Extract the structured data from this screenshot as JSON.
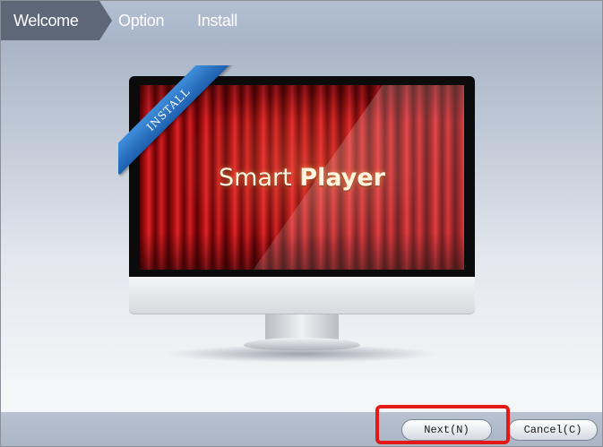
{
  "steps": [
    {
      "label": "Welcome",
      "active": true
    },
    {
      "label": "Option",
      "active": false
    },
    {
      "label": "Install",
      "active": false
    }
  ],
  "hero": {
    "ribbon_text": "INSTALL",
    "product_name_light": "Smart ",
    "product_name_bold": "Player"
  },
  "buttons": {
    "next_label": "Next(N)",
    "cancel_label": "Cancel(C)"
  },
  "colors": {
    "header_bg": "#aab6ca",
    "active_step": "#5d6778",
    "ribbon": "#2d77c8",
    "highlight": "#e51818"
  }
}
